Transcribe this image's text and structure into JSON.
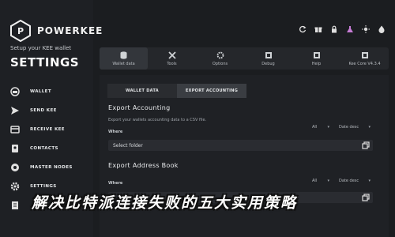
{
  "app": {
    "brand": "POWERKEE"
  },
  "sidebar": {
    "wallet_subtitle": "Setup your KEE wallet",
    "title": "SETTINGS",
    "items": [
      {
        "label": "WALLET",
        "icon": "wallet-icon"
      },
      {
        "label": "SEND KEE",
        "icon": "send-icon"
      },
      {
        "label": "RECEIVE KEE",
        "icon": "receive-icon"
      },
      {
        "label": "CONTACTS",
        "icon": "contacts-icon"
      },
      {
        "label": "MASTER NODES",
        "icon": "nodes-icon"
      },
      {
        "label": "SETTINGS",
        "icon": "gear-icon"
      },
      {
        "label": "",
        "icon": "doc-icon"
      }
    ]
  },
  "top_icons": [
    "refresh-icon",
    "gift-icon",
    "lock-icon",
    "flask-icon",
    "sun-icon",
    "fire-icon"
  ],
  "main_tabs": [
    {
      "label": "Wallet data",
      "icon": "database-icon",
      "active": true
    },
    {
      "label": "Tools",
      "icon": "tools-icon"
    },
    {
      "label": "Options",
      "icon": "options-icon"
    },
    {
      "label": "Debug",
      "icon": "debug-icon"
    },
    {
      "label": "Help",
      "icon": "help-icon"
    },
    {
      "label": "Kee Core V4.3.4",
      "icon": "info-icon"
    }
  ],
  "sub_tabs": [
    {
      "label": "WALLET DATA"
    },
    {
      "label": "EXPORT ACCOUNTING",
      "active": true
    }
  ],
  "export_accounting": {
    "title": "Export Accounting",
    "description": "Export your wallets accounting data to a CSV file.",
    "where_label": "Where",
    "filter": "All",
    "sort": "Date desc",
    "folder_placeholder": "Select folder"
  },
  "export_address_book": {
    "title": "Export Address Book",
    "where_label": "Where",
    "filter": "All",
    "sort": "Date desc"
  },
  "overlay_caption": "解决比特派连接失败的五大实用策略",
  "colors": {
    "background": "#1b1d20",
    "panel": "#1f2125",
    "accent": "#3a3d42"
  }
}
